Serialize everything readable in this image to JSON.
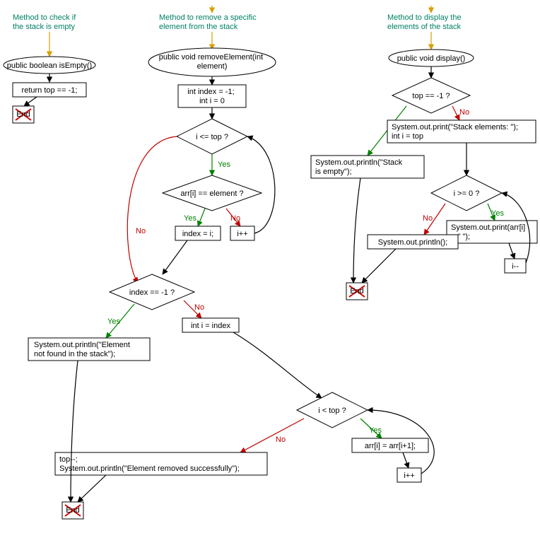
{
  "chart_data": [
    {
      "type": "flowchart",
      "title": "Method to check if the stack is empty",
      "nodes": [
        {
          "id": "c1",
          "kind": "comment",
          "text": "Method to check if\nthe stack is empty"
        },
        {
          "id": "s1",
          "kind": "start",
          "text": "public boolean isEmpty()"
        },
        {
          "id": "b1",
          "kind": "process",
          "text": "return top == -1;"
        },
        {
          "id": "e1",
          "kind": "end",
          "text": "End"
        }
      ],
      "edges": [
        {
          "from": "c1",
          "to": "s1",
          "color": "gold"
        },
        {
          "from": "s1",
          "to": "b1",
          "color": "black"
        },
        {
          "from": "b1",
          "to": "e1",
          "color": "black"
        }
      ]
    },
    {
      "type": "flowchart",
      "title": "Method to remove a specific element from the stack",
      "nodes": [
        {
          "id": "c2",
          "kind": "comment",
          "text": "Method to remove a specific\nelement from the stack"
        },
        {
          "id": "s2",
          "kind": "start",
          "text": "public void removeElement(int\nelement)"
        },
        {
          "id": "b2",
          "kind": "process",
          "text": "int index = -1;\nint i = 0"
        },
        {
          "id": "d1",
          "kind": "decision",
          "text": "i <= top ?"
        },
        {
          "id": "d2",
          "kind": "decision",
          "text": "arr[i] == element ?"
        },
        {
          "id": "b3",
          "kind": "process",
          "text": "index = i;"
        },
        {
          "id": "b4",
          "kind": "process",
          "text": "i++"
        },
        {
          "id": "d3",
          "kind": "decision",
          "text": "index == -1 ?"
        },
        {
          "id": "b5",
          "kind": "process",
          "text": "System.out.println(\"Element\nnot found in the stack\");"
        },
        {
          "id": "b6",
          "kind": "process",
          "text": "int i = index"
        },
        {
          "id": "d4",
          "kind": "decision",
          "text": "i < top ?"
        },
        {
          "id": "b7",
          "kind": "process",
          "text": "arr[i] = arr[i+1];"
        },
        {
          "id": "b8",
          "kind": "process",
          "text": "i++"
        },
        {
          "id": "b9",
          "kind": "process",
          "text": "top--;\nSystem.out.println(\"Element removed successfully\");"
        },
        {
          "id": "e2",
          "kind": "end",
          "text": "End"
        }
      ],
      "edges": [
        {
          "from": "c2",
          "to": "s2",
          "color": "gold"
        },
        {
          "from": "s2",
          "to": "b2",
          "color": "black"
        },
        {
          "from": "b2",
          "to": "d1",
          "color": "black"
        },
        {
          "from": "d1",
          "to": "d2",
          "label": "Yes",
          "color": "green"
        },
        {
          "from": "d1",
          "to": "d3",
          "label": "No",
          "color": "red"
        },
        {
          "from": "d2",
          "to": "b3",
          "label": "Yes",
          "color": "green"
        },
        {
          "from": "d2",
          "to": "b4",
          "label": "No",
          "color": "red"
        },
        {
          "from": "b3",
          "to": "d3",
          "color": "black"
        },
        {
          "from": "b4",
          "to": "d1",
          "color": "black"
        },
        {
          "from": "d3",
          "to": "b5",
          "label": "Yes",
          "color": "green"
        },
        {
          "from": "d3",
          "to": "b6",
          "label": "No",
          "color": "red"
        },
        {
          "from": "b5",
          "to": "e2",
          "color": "black"
        },
        {
          "from": "b6",
          "to": "d4",
          "color": "black"
        },
        {
          "from": "d4",
          "to": "b7",
          "label": "Yes",
          "color": "green"
        },
        {
          "from": "d4",
          "to": "b9",
          "label": "No",
          "color": "red"
        },
        {
          "from": "b7",
          "to": "b8",
          "color": "black"
        },
        {
          "from": "b8",
          "to": "d4",
          "color": "black"
        },
        {
          "from": "b9",
          "to": "e2",
          "color": "black"
        }
      ]
    },
    {
      "type": "flowchart",
      "title": "Method to display the elements of the stack",
      "nodes": [
        {
          "id": "c3",
          "kind": "comment",
          "text": "Method to display the\nelements of the stack"
        },
        {
          "id": "s3",
          "kind": "start",
          "text": "public void display()"
        },
        {
          "id": "d5",
          "kind": "decision",
          "text": "top == -1 ?"
        },
        {
          "id": "b10",
          "kind": "process",
          "text": "System.out.println(\"Stack\nis empty\");"
        },
        {
          "id": "b11",
          "kind": "process",
          "text": "System.out.print(\"Stack elements: \");\nint i = top"
        },
        {
          "id": "d6",
          "kind": "decision",
          "text": "i >= 0 ?"
        },
        {
          "id": "b12",
          "kind": "process",
          "text": "System.out.print(arr[i]\n+ \" \");"
        },
        {
          "id": "b13",
          "kind": "process",
          "text": "i--"
        },
        {
          "id": "b14",
          "kind": "process",
          "text": "System.out.println();"
        },
        {
          "id": "e3",
          "kind": "end",
          "text": "End"
        }
      ],
      "edges": [
        {
          "from": "c3",
          "to": "s3",
          "color": "gold"
        },
        {
          "from": "s3",
          "to": "d5",
          "color": "black"
        },
        {
          "from": "d5",
          "to": "b10",
          "label": "Yes",
          "color": "green"
        },
        {
          "from": "d5",
          "to": "b11",
          "label": "No",
          "color": "red"
        },
        {
          "from": "b10",
          "to": "e3",
          "color": "black"
        },
        {
          "from": "b11",
          "to": "d6",
          "color": "black"
        },
        {
          "from": "d6",
          "to": "b12",
          "label": "Yes",
          "color": "green"
        },
        {
          "from": "d6",
          "to": "b14",
          "label": "No",
          "color": "red"
        },
        {
          "from": "b12",
          "to": "b13",
          "color": "black"
        },
        {
          "from": "b13",
          "to": "d6",
          "color": "black"
        },
        {
          "from": "b14",
          "to": "e3",
          "color": "black"
        }
      ]
    }
  ],
  "labels": {
    "isEmpty_comment_l1": "Method to check if",
    "isEmpty_comment_l2": "the stack is empty",
    "isEmpty_start": "public boolean isEmpty()",
    "isEmpty_ret": "return top == -1;",
    "end": "End",
    "remove_comment_l1": "Method to remove a specific",
    "remove_comment_l2": "element from the stack",
    "remove_start_l1": "public void removeElement(int",
    "remove_start_l2": "element)",
    "remove_init_l1": "int index = -1;",
    "remove_init_l2": "int i = 0",
    "remove_d1": "i <= top ?",
    "remove_d2": "arr[i] == element ?",
    "remove_b3": "index = i;",
    "remove_b4": "i++",
    "remove_d3": "index == -1 ?",
    "remove_b5_l1": "System.out.println(\"Element",
    "remove_b5_l2": "not found in the stack\");",
    "remove_b6": "int i = index",
    "remove_d4": "i < top ?",
    "remove_b7": "arr[i] = arr[i+1];",
    "remove_b8": "i++",
    "remove_b9_l1": "top--;",
    "remove_b9_l2": "System.out.println(\"Element removed successfully\");",
    "display_comment_l1": "Method to display the",
    "display_comment_l2": "elements of the stack",
    "display_start": "public void display()",
    "display_d5": "top == -1 ?",
    "display_b10_l1": "System.out.println(\"Stack",
    "display_b10_l2": "is empty\");",
    "display_b11_l1": "System.out.print(\"Stack elements: \");",
    "display_b11_l2": "int i = top",
    "display_d6": "i >= 0 ?",
    "display_b12_l1": "System.out.print(arr[i]",
    "display_b12_l2": "+ \" \");",
    "display_b13": "i--",
    "display_b14": "System.out.println();",
    "yes": "Yes",
    "no": "No"
  }
}
